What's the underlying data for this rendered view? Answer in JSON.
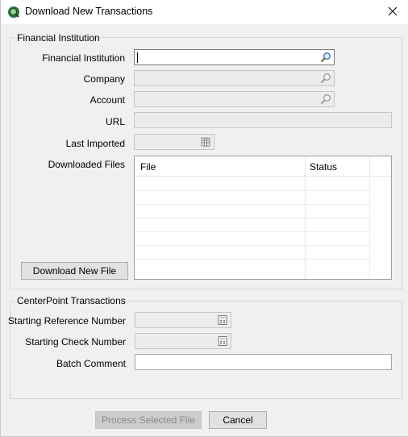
{
  "window": {
    "title": "Download New Transactions",
    "close_icon": "close-icon",
    "app_icon": "app-logo-icon"
  },
  "financial_group": {
    "legend": "Financial Institution",
    "fields": {
      "financial_institution": {
        "label": "Financial Institution",
        "value": "",
        "icon": "search-icon"
      },
      "company": {
        "label": "Company",
        "value": "",
        "icon": "search-icon"
      },
      "account": {
        "label": "Account",
        "value": "",
        "icon": "search-icon"
      },
      "url": {
        "label": "URL",
        "value": ""
      },
      "last_imported": {
        "label": "Last Imported",
        "value": "",
        "icon": "calendar-icon"
      }
    },
    "downloaded_files": {
      "label": "Downloaded Files",
      "columns": [
        "File",
        "Status"
      ],
      "rows": []
    },
    "download_button": "Download New File"
  },
  "centerpoint_group": {
    "legend": "CenterPoint Transactions",
    "fields": {
      "starting_reference": {
        "label": "Starting Reference Number",
        "value": "",
        "icon": "calculator-icon"
      },
      "starting_check": {
        "label": "Starting Check Number",
        "value": "",
        "icon": "calculator-icon"
      },
      "batch_comment": {
        "label": "Batch Comment",
        "value": ""
      }
    }
  },
  "actions": {
    "process_label": "Process Selected File",
    "process_enabled": false,
    "cancel_label": "Cancel"
  }
}
